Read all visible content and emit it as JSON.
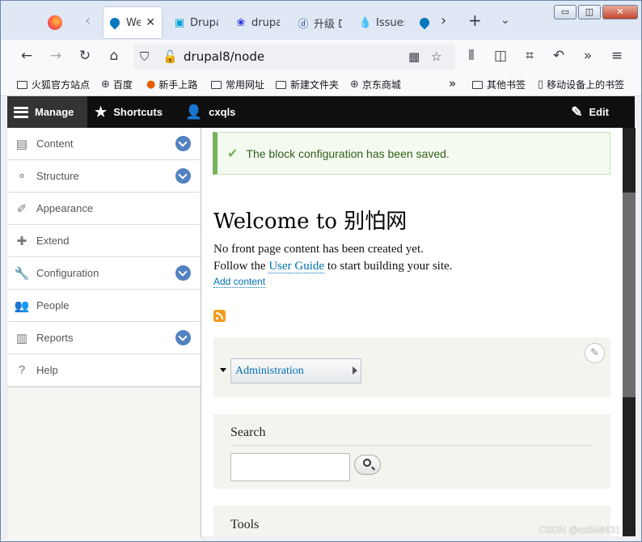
{
  "browser": {
    "tabs": [
      {
        "label": "We",
        "active": true
      },
      {
        "label": "Drupa"
      },
      {
        "label": "drupa"
      },
      {
        "label": "升级 D"
      },
      {
        "label": "Issues"
      }
    ],
    "new_tab_icon": "plus-icon",
    "url": "drupal8/node",
    "window_buttons": {
      "minimize": "▭",
      "restore": "◫",
      "close": "✕"
    }
  },
  "bookmarks": [
    {
      "label": "火狐官方站点",
      "icon": "folder-icon"
    },
    {
      "label": "百度",
      "icon": "globe-icon"
    },
    {
      "label": "新手上路",
      "icon": "firefox-icon"
    },
    {
      "label": "常用网址",
      "icon": "folder-icon"
    },
    {
      "label": "新建文件夹",
      "icon": "folder-icon"
    },
    {
      "label": "京东商城",
      "icon": "globe-icon"
    },
    {
      "label": "其他书签",
      "icon": "folder-icon"
    },
    {
      "label": "移动设备上的书签",
      "icon": "mobile-icon"
    }
  ],
  "toolbar": {
    "manage": "Manage",
    "shortcuts": "Shortcuts",
    "user": "cxqls",
    "edit": "Edit"
  },
  "tray": {
    "items": [
      {
        "label": "Content",
        "icon": "content-icon",
        "expandable": true
      },
      {
        "label": "Structure",
        "icon": "structure-icon",
        "expandable": true
      },
      {
        "label": "Appearance",
        "icon": "appearance-icon",
        "expandable": false
      },
      {
        "label": "Extend",
        "icon": "extend-icon",
        "expandable": false
      },
      {
        "label": "Configuration",
        "icon": "wrench-icon",
        "expandable": true
      },
      {
        "label": "People",
        "icon": "people-icon",
        "expandable": false
      },
      {
        "label": "Reports",
        "icon": "reports-icon",
        "expandable": true
      },
      {
        "label": "Help",
        "icon": "help-icon",
        "expandable": false
      }
    ]
  },
  "content": {
    "status_message": "The block configuration has been saved.",
    "title": "Welcome to 别怕网",
    "line1": "No front page content has been created yet.",
    "line2_pre": "Follow the",
    "line2_link": "User Guide",
    "line2_post": "to start building your site.",
    "add_content": "Add content",
    "admin_menu_item": "Administration",
    "search_title": "Search",
    "tools_title": "Tools"
  },
  "watermark": "CSDN @cs548431",
  "colors": {
    "toolbar_bg": "#0f0f0f",
    "toggle_blue": "#5282c1",
    "link": "#0071b3",
    "status_green": "#77b259"
  }
}
